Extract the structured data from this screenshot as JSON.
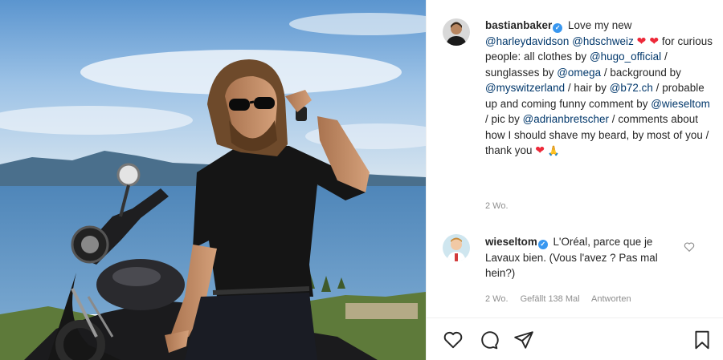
{
  "post": {
    "author": "bastianbaker",
    "caption_segments": [
      {
        "t": "Love my new ",
        "c": "text"
      },
      {
        "t": "@harleydavidson",
        "c": "link"
      },
      {
        "t": " ",
        "c": "text"
      },
      {
        "t": "@hdschweiz",
        "c": "link"
      },
      {
        "t": " ",
        "c": "text"
      },
      {
        "t": "❤ ❤",
        "c": "heart"
      },
      {
        "t": " for curious people: all clothes by ",
        "c": "text"
      },
      {
        "t": "@hugo_official",
        "c": "link"
      },
      {
        "t": " / sunglasses by ",
        "c": "text"
      },
      {
        "t": "@omega",
        "c": "link"
      },
      {
        "t": " / background by ",
        "c": "text"
      },
      {
        "t": "@myswitzerland",
        "c": "link"
      },
      {
        "t": " / hair by ",
        "c": "text"
      },
      {
        "t": "@b72.ch",
        "c": "link"
      },
      {
        "t": " / probable up and coming funny comment by ",
        "c": "text"
      },
      {
        "t": "@wieseltom",
        "c": "link"
      },
      {
        "t": " / pic by ",
        "c": "text"
      },
      {
        "t": "@adrianbretscher",
        "c": "link"
      },
      {
        "t": " / comments about how I should shave my beard, by most of you / thank you ",
        "c": "text"
      },
      {
        "t": "❤",
        "c": "heart"
      },
      {
        "t": " 🙏",
        "c": "pray"
      }
    ],
    "caption_time": "2 Wo."
  },
  "comment": {
    "author": "wieseltom",
    "text": "L'Oréal, parce que je Lavaux bien. (Vous l'avez ? Pas mal hein?)",
    "time": "2 Wo.",
    "likes": "Gefällt 138 Mal",
    "reply": "Antworten"
  },
  "icons": {
    "like": "heart-outline-icon",
    "comment": "speech-bubble-icon",
    "share": "paper-plane-icon",
    "save": "bookmark-icon"
  },
  "colors": {
    "link": "#00376b",
    "verified": "#3897f0",
    "meta": "#8e8e8e",
    "heart": "#ed2939"
  }
}
